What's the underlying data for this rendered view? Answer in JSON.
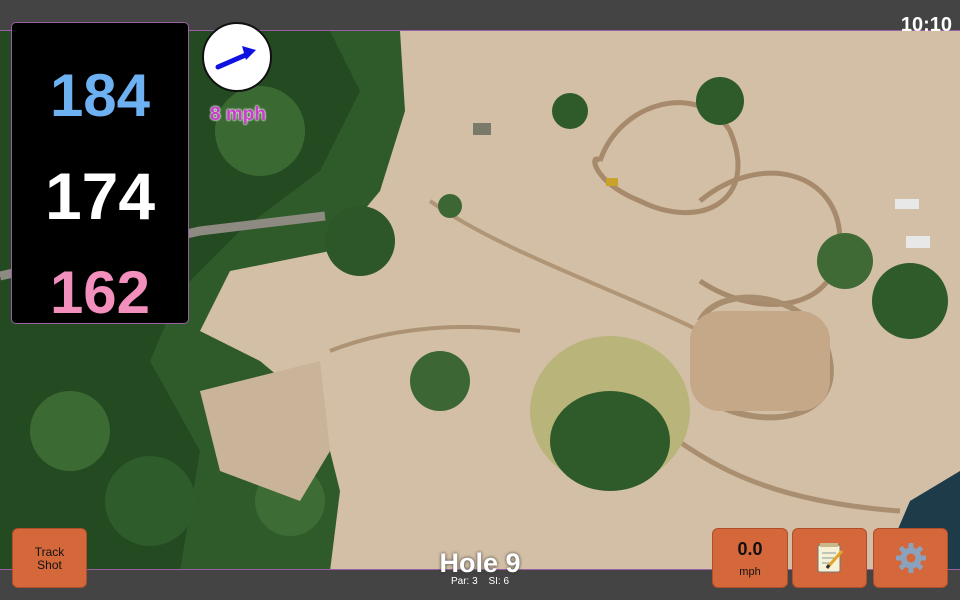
{
  "status": {
    "time": "10:10"
  },
  "distances": {
    "back": "184",
    "middle": "174",
    "front": "162"
  },
  "wind": {
    "speed": "8 mph",
    "icon": "arrow-icon",
    "arrow_color": "#1010e0"
  },
  "buttons": {
    "track_shot_label": "Track Shot",
    "speed_value": "0.0",
    "speed_unit": "mph",
    "notes_icon": "notepad-icon",
    "settings_icon": "gear-icon"
  },
  "hole": {
    "title": "Hole 9",
    "par": "Par: 3",
    "si": "SI: 6"
  },
  "colors": {
    "back": "#6db1f2",
    "middle": "#ffffff",
    "front": "#f38fbd",
    "button": "#d4683a",
    "wind_text": "#c83ec8"
  }
}
